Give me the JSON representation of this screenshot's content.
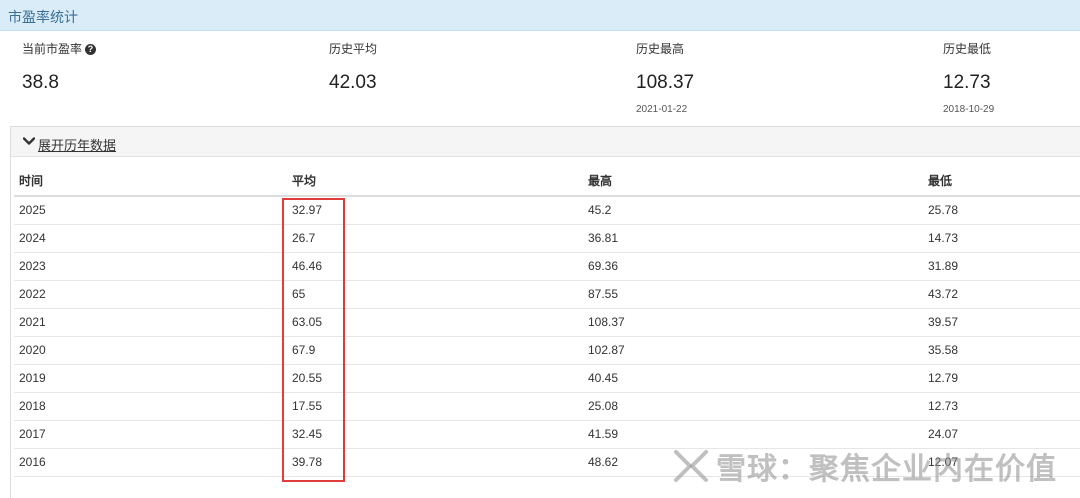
{
  "panel": {
    "title": "市盈率统计"
  },
  "stats": {
    "current": {
      "label": "当前市盈率",
      "value": "38.8",
      "help_icon": "question-circle-icon"
    },
    "average": {
      "label": "历史平均",
      "value": "42.03"
    },
    "max": {
      "label": "历史最高",
      "value": "108.37",
      "date": "2021-01-22"
    },
    "min": {
      "label": "历史最低",
      "value": "12.73",
      "date": "2018-10-29"
    }
  },
  "history": {
    "toggle_label": "展开历年数据",
    "toggle_icon": "chevron-down-icon",
    "columns": [
      "时间",
      "平均",
      "最高",
      "最低"
    ],
    "rows": [
      [
        "2025",
        "32.97",
        "45.2",
        "25.78"
      ],
      [
        "2024",
        "26.7",
        "36.81",
        "14.73"
      ],
      [
        "2023",
        "46.46",
        "69.36",
        "31.89"
      ],
      [
        "2022",
        "65",
        "87.55",
        "43.72"
      ],
      [
        "2021",
        "63.05",
        "108.37",
        "39.57"
      ],
      [
        "2020",
        "67.9",
        "102.87",
        "35.58"
      ],
      [
        "2019",
        "20.55",
        "40.45",
        "12.79"
      ],
      [
        "2018",
        "17.55",
        "25.08",
        "12.73"
      ],
      [
        "2017",
        "32.45",
        "41.59",
        "24.07"
      ],
      [
        "2016",
        "39.78",
        "48.62",
        "12.07"
      ]
    ]
  },
  "watermark": {
    "text": "雪球：聚焦企业内在价值",
    "icon": "snowball-logo-icon"
  },
  "colors": {
    "header_bg": "#d9ecf7",
    "title": "#3a6f98",
    "highlight": "#e03c3c"
  }
}
